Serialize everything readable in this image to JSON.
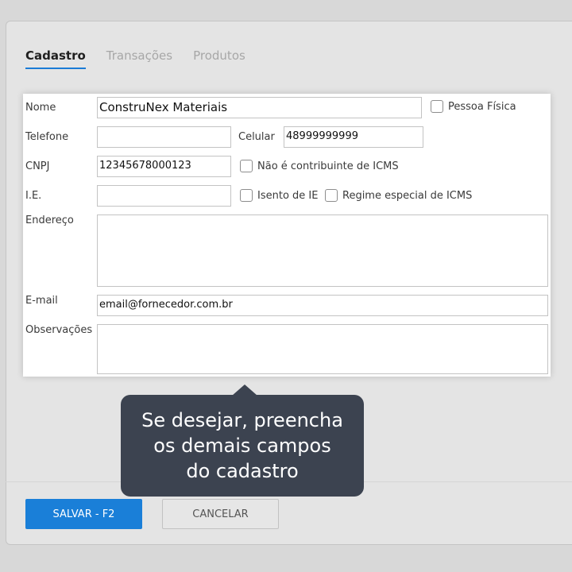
{
  "tabs": [
    {
      "label": "Cadastro",
      "active": true
    },
    {
      "label": "Transações",
      "active": false
    },
    {
      "label": "Produtos",
      "active": false
    }
  ],
  "form": {
    "nome": {
      "label": "Nome",
      "value": "ConstruNex Materiais"
    },
    "pessoa_fisica": {
      "label": "Pessoa Física",
      "checked": false
    },
    "telefone": {
      "label": "Telefone",
      "value": ""
    },
    "celular": {
      "label": "Celular",
      "value": "48999999999"
    },
    "cnpj": {
      "label": "CNPJ",
      "value": "12345678000123"
    },
    "nao_contribuinte": {
      "label": "Não é contribuinte de ICMS",
      "checked": false
    },
    "ie": {
      "label": "I.E.",
      "value": ""
    },
    "isento_ie": {
      "label": "Isento de IE",
      "checked": false
    },
    "regime_especial": {
      "label": "Regime especial de ICMS",
      "checked": false
    },
    "endereco": {
      "label": "Endereço",
      "value": ""
    },
    "email": {
      "label": "E-mail",
      "value": "email@fornecedor.com.br"
    },
    "observacoes": {
      "label": "Observações",
      "value": ""
    }
  },
  "tooltip": {
    "lines": [
      "Se desejar, preencha",
      "os demais campos",
      "do cadastro"
    ]
  },
  "footer": {
    "save_label": "SALVAR - F2",
    "cancel_label": "CANCELAR"
  },
  "colors": {
    "accent": "#1a7fd8",
    "tooltip_bg": "#3c4350",
    "page_bg": "#d8d8d8"
  }
}
